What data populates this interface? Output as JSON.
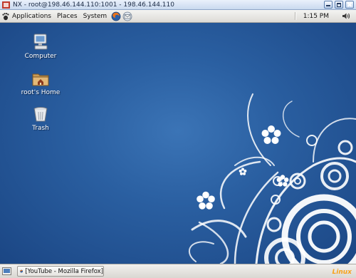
{
  "window": {
    "title": "NX - root@198.46.144.110:1001 - 198.46.144.110"
  },
  "top_panel": {
    "menus": [
      {
        "label": "Applications",
        "icon": "gnome-foot-icon"
      },
      {
        "label": "Places"
      },
      {
        "label": "System"
      }
    ],
    "launchers": [
      "firefox-launcher-icon",
      "mail-launcher-icon"
    ],
    "clock": "1:15 PM",
    "tray_icon": "volume-icon"
  },
  "desktop": {
    "icons": [
      {
        "label": "Computer",
        "icon": "computer-icon"
      },
      {
        "label": "root's Home",
        "icon": "home-folder-icon"
      },
      {
        "label": "Trash",
        "icon": "trash-icon"
      }
    ],
    "wallpaper_colors": {
      "base": "#1d4f8f",
      "highlight": "#3b74b6",
      "swirl": "#ffffff"
    }
  },
  "bottom_panel": {
    "taskbar": [
      {
        "label": "[YouTube - Mozilla Firefox]",
        "icon": "firefox-icon"
      }
    ],
    "watermark": "Linux"
  }
}
